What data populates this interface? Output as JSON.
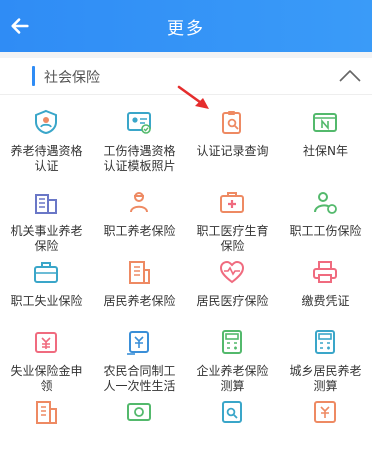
{
  "header": {
    "title": "更多"
  },
  "section": {
    "title": "社会保险"
  },
  "items": [
    {
      "label": "养老待遇资格\n认证"
    },
    {
      "label": "工伤待遇资格\n认证模板照片"
    },
    {
      "label": "认证记录查询"
    },
    {
      "label": "社保N年"
    },
    {
      "label": "机关事业养老\n保险"
    },
    {
      "label": "职工养老保险"
    },
    {
      "label": "职工医疗生育\n保险"
    },
    {
      "label": "职工工伤保险"
    },
    {
      "label": "职工失业保险"
    },
    {
      "label": "居民养老保险"
    },
    {
      "label": "居民医疗保险"
    },
    {
      "label": "缴费凭证"
    },
    {
      "label": "失业保险金申\n领"
    },
    {
      "label": "农民合同制工\n人一次性生活"
    },
    {
      "label": "企业养老保险\n测算"
    },
    {
      "label": "城乡居民养老\n测算"
    }
  ],
  "icons": {
    "c1": "#3aa6c9",
    "c2": "#ee8a63",
    "c3": "#53b96c",
    "c4": "#f06b7f",
    "c5": "#6a77c7"
  }
}
